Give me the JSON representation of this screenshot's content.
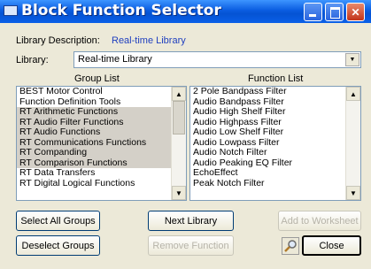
{
  "window": {
    "title": "Block Function Selector",
    "min_icon": "minimize-icon",
    "max_icon": "maximize-icon",
    "close_icon": "close-icon",
    "close_glyph": "✕"
  },
  "library_description": {
    "label": "Library Description:",
    "value": "Real-time Library"
  },
  "library": {
    "label": "Library:",
    "selected": "Real-time Library",
    "arrow_glyph": "▼"
  },
  "group_list": {
    "header": "Group List",
    "items": [
      {
        "label": "BEST Motor Control",
        "selected": false
      },
      {
        "label": "Function Definition Tools",
        "selected": false
      },
      {
        "label": "RT Arithmetic Functions",
        "selected": true
      },
      {
        "label": "RT Audio Filter Functions",
        "selected": true
      },
      {
        "label": "RT Audio Functions",
        "selected": true
      },
      {
        "label": "RT Communications Functions",
        "selected": true
      },
      {
        "label": "RT Companding",
        "selected": true
      },
      {
        "label": "RT Comparison Functions",
        "selected": true
      },
      {
        "label": "RT Data Transfers",
        "selected": false
      },
      {
        "label": "RT Digital Logical Functions",
        "selected": false
      }
    ]
  },
  "function_list": {
    "header": "Function List",
    "items": [
      "2 Pole Bandpass Filter",
      "Audio Bandpass Filter",
      "Audio High Shelf Filter",
      "Audio Highpass Filter",
      "Audio Low Shelf Filter",
      "Audio Lowpass Filter",
      "Audio Notch Filter",
      "Audio Peaking EQ Filter",
      "EchoEffect",
      "Peak Notch Filter"
    ]
  },
  "scroll": {
    "up_glyph": "▲",
    "down_glyph": "▼"
  },
  "buttons": {
    "select_all_groups": "Select All Groups",
    "next_library": "Next Library",
    "add_to_worksheet": "Add to Worksheet",
    "deselect_groups": "Deselect Groups",
    "remove_function": "Remove Function",
    "close": "Close",
    "search_icon": "magnifier-icon"
  },
  "colors": {
    "accent": "#1f3fbf",
    "titlebar": "#0a5ce0",
    "selected_row": "#d4d0c8"
  }
}
